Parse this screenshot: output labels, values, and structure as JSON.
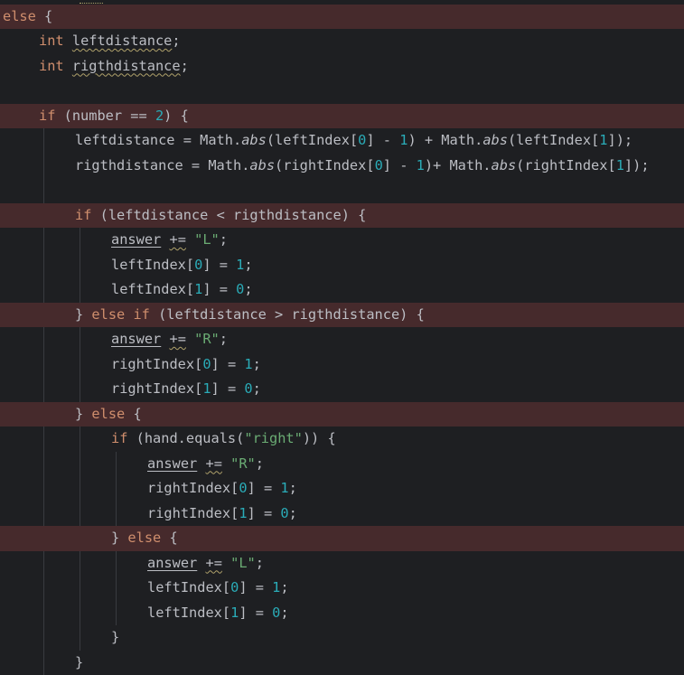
{
  "editor": {
    "colors": {
      "background": "#1e1f22",
      "highlight_row": "#462a2c",
      "keyword": "#cf8e6d",
      "number": "#2aacb8",
      "string": "#6aab73",
      "text": "#bcbec4",
      "warning_underline": "#b0a26b"
    },
    "lines": [
      {
        "indent": 0,
        "highlight": true,
        "tokens": [
          {
            "text": "else",
            "style": "kw"
          },
          {
            "text": " {",
            "style": "var"
          }
        ]
      },
      {
        "indent": 1,
        "highlight": false,
        "tokens": [
          {
            "text": "int",
            "style": "kw"
          },
          {
            "text": " ",
            "style": "var"
          },
          {
            "text": "leftdistance",
            "style": "var uw"
          },
          {
            "text": ";",
            "style": "var"
          }
        ]
      },
      {
        "indent": 1,
        "highlight": false,
        "tokens": [
          {
            "text": "int",
            "style": "kw"
          },
          {
            "text": " ",
            "style": "var"
          },
          {
            "text": "rigthdistance",
            "style": "var uw"
          },
          {
            "text": ";",
            "style": "var"
          }
        ]
      },
      {
        "indent": 0,
        "highlight": false,
        "tokens": []
      },
      {
        "indent": 1,
        "highlight": true,
        "tokens": [
          {
            "text": "if",
            "style": "kw"
          },
          {
            "text": " (number == ",
            "style": "var"
          },
          {
            "text": "2",
            "style": "num"
          },
          {
            "text": ") {",
            "style": "var"
          }
        ]
      },
      {
        "indent": 2,
        "highlight": false,
        "tokens": [
          {
            "text": "leftdistance = Math.",
            "style": "var"
          },
          {
            "text": "abs",
            "style": "fn"
          },
          {
            "text": "(leftIndex[",
            "style": "var"
          },
          {
            "text": "0",
            "style": "num"
          },
          {
            "text": "] - ",
            "style": "var"
          },
          {
            "text": "1",
            "style": "num"
          },
          {
            "text": ") + Math.",
            "style": "var"
          },
          {
            "text": "abs",
            "style": "fn"
          },
          {
            "text": "(leftIndex[",
            "style": "var"
          },
          {
            "text": "1",
            "style": "num"
          },
          {
            "text": "]);",
            "style": "var"
          }
        ]
      },
      {
        "indent": 2,
        "highlight": false,
        "tokens": [
          {
            "text": "rigthdistance = Math.",
            "style": "var"
          },
          {
            "text": "abs",
            "style": "fn"
          },
          {
            "text": "(rightIndex[",
            "style": "var"
          },
          {
            "text": "0",
            "style": "num"
          },
          {
            "text": "] - ",
            "style": "var"
          },
          {
            "text": "1",
            "style": "num"
          },
          {
            "text": ")+ Math.",
            "style": "var"
          },
          {
            "text": "abs",
            "style": "fn"
          },
          {
            "text": "(rightIndex[",
            "style": "var"
          },
          {
            "text": "1",
            "style": "num"
          },
          {
            "text": "]);",
            "style": "var"
          }
        ]
      },
      {
        "indent": 0,
        "highlight": false,
        "tokens": []
      },
      {
        "indent": 2,
        "highlight": true,
        "tokens": [
          {
            "text": "if",
            "style": "kw"
          },
          {
            "text": " (leftdistance < rigthdistance) {",
            "style": "var"
          }
        ]
      },
      {
        "indent": 3,
        "highlight": false,
        "tokens": [
          {
            "text": "answer",
            "style": "var ul"
          },
          {
            "text": " ",
            "style": "var"
          },
          {
            "text": "+=",
            "style": "var uw"
          },
          {
            "text": " ",
            "style": "var"
          },
          {
            "text": "\"L\"",
            "style": "str"
          },
          {
            "text": ";",
            "style": "var"
          }
        ]
      },
      {
        "indent": 3,
        "highlight": false,
        "tokens": [
          {
            "text": "leftIndex[",
            "style": "var"
          },
          {
            "text": "0",
            "style": "num"
          },
          {
            "text": "] = ",
            "style": "var"
          },
          {
            "text": "1",
            "style": "num"
          },
          {
            "text": ";",
            "style": "var"
          }
        ]
      },
      {
        "indent": 3,
        "highlight": false,
        "tokens": [
          {
            "text": "leftIndex[",
            "style": "var"
          },
          {
            "text": "1",
            "style": "num"
          },
          {
            "text": "] = ",
            "style": "var"
          },
          {
            "text": "0",
            "style": "num"
          },
          {
            "text": ";",
            "style": "var"
          }
        ]
      },
      {
        "indent": 2,
        "highlight": true,
        "tokens": [
          {
            "text": "} ",
            "style": "var"
          },
          {
            "text": "else if",
            "style": "kw"
          },
          {
            "text": " (leftdistance > rigthdistance) {",
            "style": "var"
          }
        ]
      },
      {
        "indent": 3,
        "highlight": false,
        "tokens": [
          {
            "text": "answer",
            "style": "var ul"
          },
          {
            "text": " ",
            "style": "var"
          },
          {
            "text": "+=",
            "style": "var uw"
          },
          {
            "text": " ",
            "style": "var"
          },
          {
            "text": "\"R\"",
            "style": "str"
          },
          {
            "text": ";",
            "style": "var"
          }
        ]
      },
      {
        "indent": 3,
        "highlight": false,
        "tokens": [
          {
            "text": "rightIndex[",
            "style": "var"
          },
          {
            "text": "0",
            "style": "num"
          },
          {
            "text": "] = ",
            "style": "var"
          },
          {
            "text": "1",
            "style": "num"
          },
          {
            "text": ";",
            "style": "var"
          }
        ]
      },
      {
        "indent": 3,
        "highlight": false,
        "tokens": [
          {
            "text": "rightIndex[",
            "style": "var"
          },
          {
            "text": "1",
            "style": "num"
          },
          {
            "text": "] = ",
            "style": "var"
          },
          {
            "text": "0",
            "style": "num"
          },
          {
            "text": ";",
            "style": "var"
          }
        ]
      },
      {
        "indent": 2,
        "highlight": true,
        "tokens": [
          {
            "text": "} ",
            "style": "var"
          },
          {
            "text": "else",
            "style": "kw"
          },
          {
            "text": " {",
            "style": "var"
          }
        ]
      },
      {
        "indent": 3,
        "highlight": false,
        "tokens": [
          {
            "text": "if",
            "style": "kw"
          },
          {
            "text": " (hand.equals(",
            "style": "var"
          },
          {
            "text": "\"right\"",
            "style": "str"
          },
          {
            "text": ")) {",
            "style": "var"
          }
        ]
      },
      {
        "indent": 4,
        "highlight": false,
        "tokens": [
          {
            "text": "answer",
            "style": "var ul"
          },
          {
            "text": " ",
            "style": "var"
          },
          {
            "text": "+=",
            "style": "var uw"
          },
          {
            "text": " ",
            "style": "var"
          },
          {
            "text": "\"R\"",
            "style": "str"
          },
          {
            "text": ";",
            "style": "var"
          }
        ]
      },
      {
        "indent": 4,
        "highlight": false,
        "tokens": [
          {
            "text": "rightIndex[",
            "style": "var"
          },
          {
            "text": "0",
            "style": "num"
          },
          {
            "text": "] = ",
            "style": "var"
          },
          {
            "text": "1",
            "style": "num"
          },
          {
            "text": ";",
            "style": "var"
          }
        ]
      },
      {
        "indent": 4,
        "highlight": false,
        "tokens": [
          {
            "text": "rightIndex[",
            "style": "var"
          },
          {
            "text": "1",
            "style": "num"
          },
          {
            "text": "] = ",
            "style": "var"
          },
          {
            "text": "0",
            "style": "num"
          },
          {
            "text": ";",
            "style": "var"
          }
        ]
      },
      {
        "indent": 3,
        "highlight": true,
        "tokens": [
          {
            "text": "} ",
            "style": "var"
          },
          {
            "text": "else",
            "style": "kw"
          },
          {
            "text": " {",
            "style": "var"
          }
        ]
      },
      {
        "indent": 4,
        "highlight": false,
        "tokens": [
          {
            "text": "answer",
            "style": "var ul"
          },
          {
            "text": " ",
            "style": "var"
          },
          {
            "text": "+=",
            "style": "var uw"
          },
          {
            "text": " ",
            "style": "var"
          },
          {
            "text": "\"L\"",
            "style": "str"
          },
          {
            "text": ";",
            "style": "var"
          }
        ]
      },
      {
        "indent": 4,
        "highlight": false,
        "tokens": [
          {
            "text": "leftIndex[",
            "style": "var"
          },
          {
            "text": "0",
            "style": "num"
          },
          {
            "text": "] = ",
            "style": "var"
          },
          {
            "text": "1",
            "style": "num"
          },
          {
            "text": ";",
            "style": "var"
          }
        ]
      },
      {
        "indent": 4,
        "highlight": false,
        "tokens": [
          {
            "text": "leftIndex[",
            "style": "var"
          },
          {
            "text": "1",
            "style": "num"
          },
          {
            "text": "] = ",
            "style": "var"
          },
          {
            "text": "0",
            "style": "num"
          },
          {
            "text": ";",
            "style": "var"
          }
        ]
      },
      {
        "indent": 3,
        "highlight": false,
        "tokens": [
          {
            "text": "}",
            "style": "var"
          }
        ]
      },
      {
        "indent": 2,
        "highlight": false,
        "tokens": [
          {
            "text": "}",
            "style": "var"
          }
        ]
      }
    ]
  }
}
